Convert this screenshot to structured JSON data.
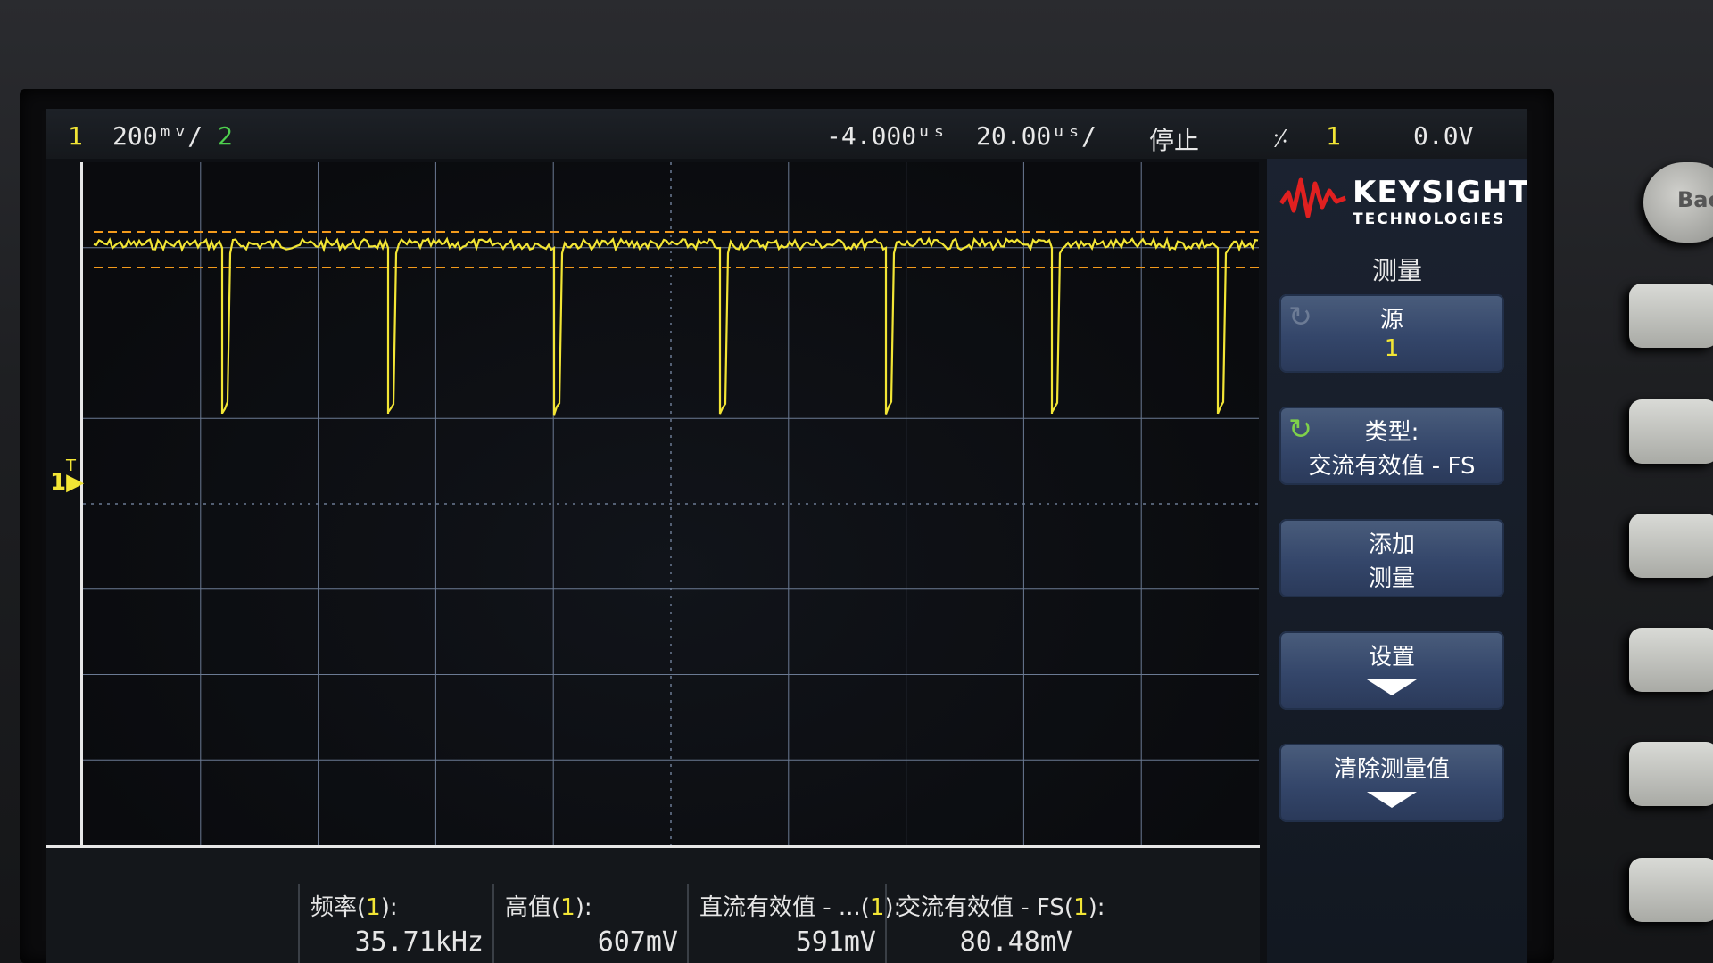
{
  "topbar": {
    "ch1_num": "1",
    "ch1_scale": "200ᵐᵛ/",
    "ch2_num": "2",
    "time_delay": "-4.000ᵘˢ",
    "time_scale": "20.00ᵘˢ/",
    "run_state": "停止",
    "trigger_icon": "edge-trigger-icon",
    "trigger_source": "1",
    "trigger_level": "0.0V"
  },
  "plot": {
    "ground_marker": "1",
    "ground_marker_t": "T",
    "trace_color": "#f2e535",
    "cursor_color": "#f39a1c",
    "grid_color": "#6b7a93"
  },
  "panel": {
    "logo_word": "KEYSIGHT",
    "logo_sub": "TECHNOLOGIES",
    "title": "测量",
    "source_label": "源",
    "source_value": "1",
    "type_label": "类型:",
    "type_value": "交流有效值 - FS",
    "add_label1": "添加",
    "add_label2": "测量",
    "settings_label": "设置",
    "clear_label": "清除测量值"
  },
  "measurements": [
    {
      "label_pre": "频率(",
      "label_num": "1",
      "label_post": "):",
      "value": "35.71kHz"
    },
    {
      "label_pre": "高值(",
      "label_num": "1",
      "label_post": "):",
      "value": "607mV"
    },
    {
      "label_pre": "直流有效值 - ...(",
      "label_num": "1",
      "label_post": "):",
      "value": "591mV"
    },
    {
      "label_pre": "交流有效值 - FS(",
      "label_num": "1",
      "label_post": "):",
      "value": "80.48mV"
    }
  ],
  "hardware": {
    "back_label": "Bac"
  }
}
